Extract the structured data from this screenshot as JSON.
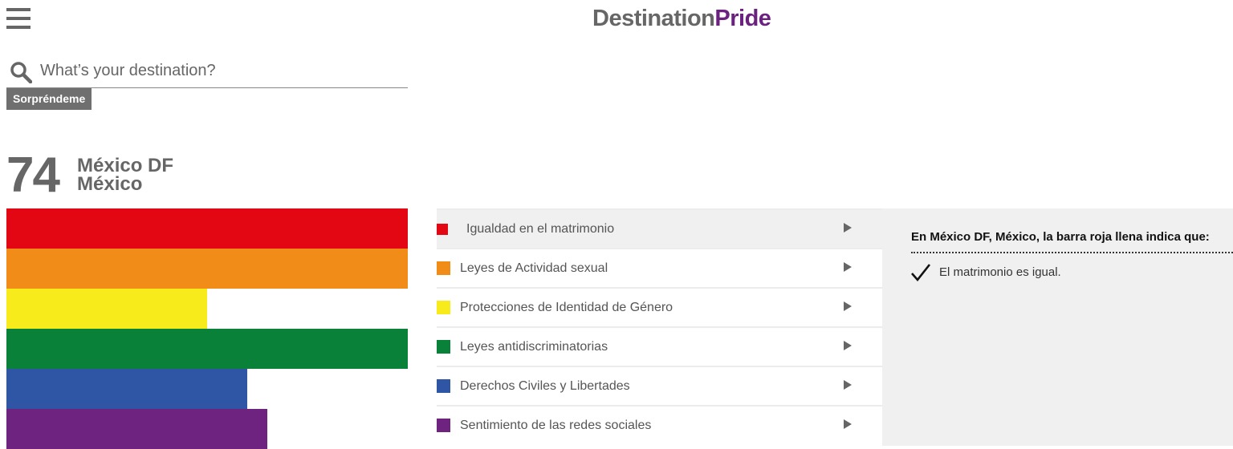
{
  "header": {
    "logo_part1": "Destination",
    "logo_part2": "Pride",
    "menu_icon": "hamburger-menu-icon"
  },
  "search": {
    "icon": "search-icon",
    "placeholder": "What’s your destination?",
    "value": ""
  },
  "surprise_button": "Sorpréndeme",
  "destination": {
    "score": "74",
    "city": "México DF",
    "country": "México"
  },
  "bars": [
    {
      "color": "#e30613",
      "fill": 1.0
    },
    {
      "color": "#f28c18",
      "fill": 1.0
    },
    {
      "color": "#f8eb1c",
      "fill": 0.5
    },
    {
      "color": "#0a8139",
      "fill": 1.0
    },
    {
      "color": "#2e56a5",
      "fill": 0.6
    },
    {
      "color": "#6f2381",
      "fill": 0.65
    }
  ],
  "categories": [
    {
      "label": "Igualdad en el matrimonio",
      "color": "#e30613",
      "selected": true
    },
    {
      "label": "Leyes de Actividad sexual",
      "color": "#f28c18",
      "selected": false
    },
    {
      "label": "Protecciones de Identidad de Género",
      "color": "#f8eb1c",
      "selected": false
    },
    {
      "label": "Leyes antidiscriminatorias",
      "color": "#0a8139",
      "selected": false
    },
    {
      "label": "Derechos Civiles y Libertades",
      "color": "#2e56a5",
      "selected": false
    },
    {
      "label": "Sentimiento de las redes sociales",
      "color": "#6f2381",
      "selected": false
    }
  ],
  "info_panel": {
    "heading": "En México DF, México, la barra roja llena indica que:",
    "items": [
      {
        "icon": "checkmark-icon",
        "text": "El matrimonio es igual."
      }
    ]
  }
}
